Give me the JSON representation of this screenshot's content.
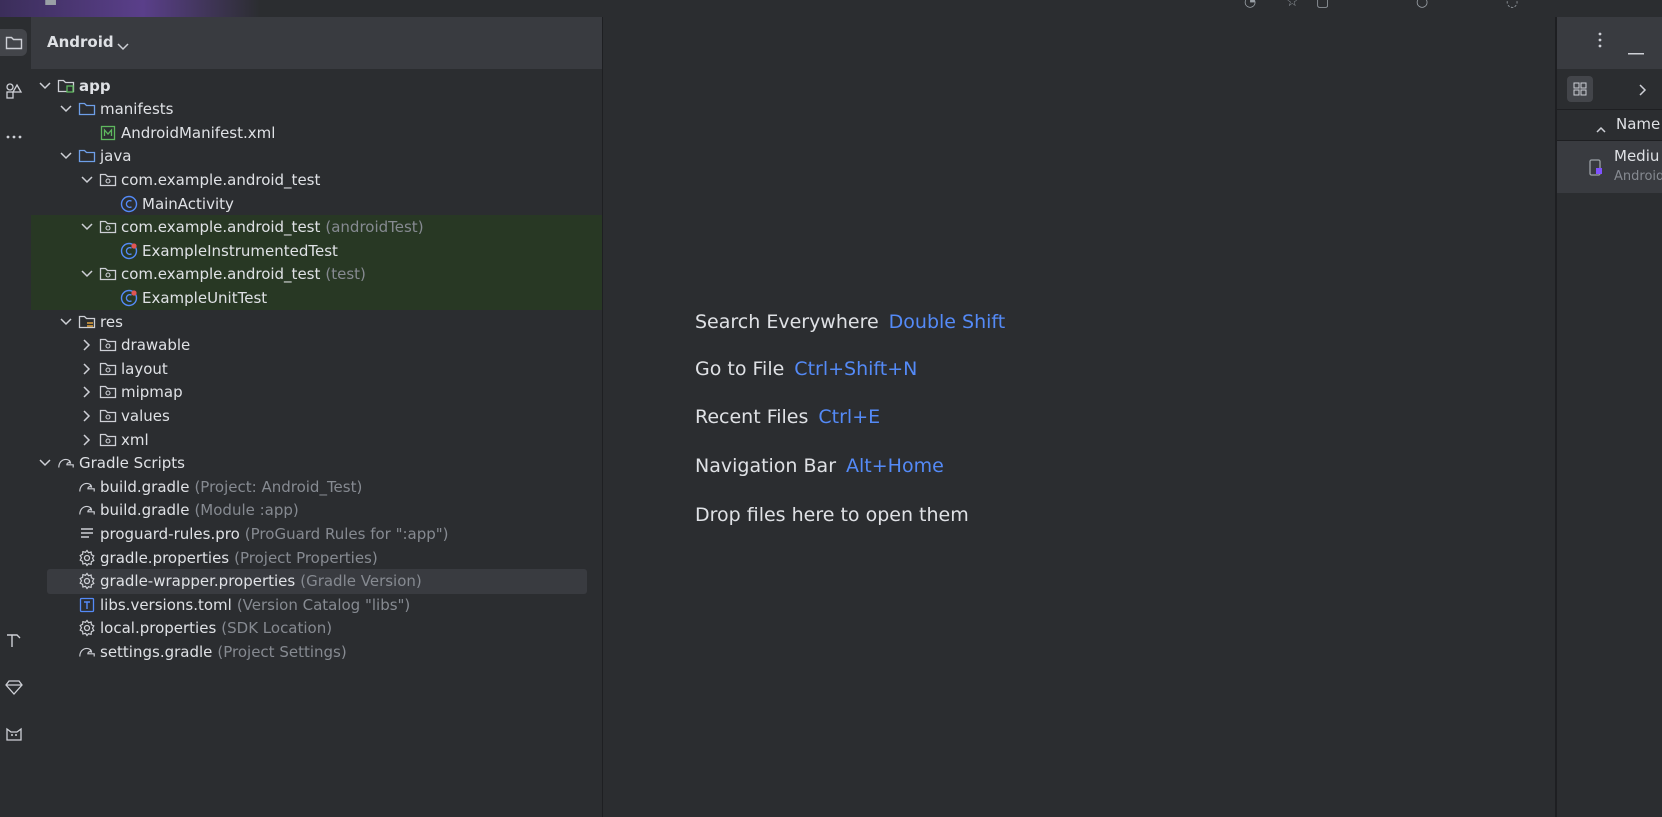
{
  "project_panel": {
    "view_title": "Android",
    "tree": [
      {
        "label": "app",
        "depth": 0,
        "expanded": true,
        "icon": "module-folder-icon",
        "bold": true
      },
      {
        "label": "manifests",
        "depth": 1,
        "expanded": true,
        "icon": "folder-icon"
      },
      {
        "label": "AndroidManifest.xml",
        "depth": 2,
        "icon": "manifest-file-icon"
      },
      {
        "label": "java",
        "depth": 1,
        "expanded": true,
        "icon": "folder-icon"
      },
      {
        "label": "com.example.android_test",
        "depth": 2,
        "expanded": true,
        "icon": "package-icon"
      },
      {
        "label": "MainActivity",
        "depth": 3,
        "icon": "class-icon"
      },
      {
        "label": "com.example.android_test",
        "hint": "(androidTest)",
        "depth": 2,
        "expanded": true,
        "icon": "package-icon",
        "highlight": true
      },
      {
        "label": "ExampleInstrumentedTest",
        "depth": 3,
        "icon": "test-class-icon",
        "highlight": true
      },
      {
        "label": "com.example.android_test",
        "hint": "(test)",
        "depth": 2,
        "expanded": true,
        "icon": "package-icon",
        "highlight": true
      },
      {
        "label": "ExampleUnitTest",
        "depth": 3,
        "icon": "test-class-icon",
        "highlight": true
      },
      {
        "label": "res",
        "depth": 1,
        "expanded": true,
        "icon": "resources-folder-icon"
      },
      {
        "label": "drawable",
        "depth": 2,
        "expanded": false,
        "icon": "package-icon"
      },
      {
        "label": "layout",
        "depth": 2,
        "expanded": false,
        "icon": "package-icon"
      },
      {
        "label": "mipmap",
        "depth": 2,
        "expanded": false,
        "icon": "package-icon"
      },
      {
        "label": "values",
        "depth": 2,
        "expanded": false,
        "icon": "package-icon"
      },
      {
        "label": "xml",
        "depth": 2,
        "expanded": false,
        "icon": "package-icon"
      },
      {
        "label": "Gradle Scripts",
        "depth": 0,
        "expanded": true,
        "icon": "gradle-icon"
      },
      {
        "label": "build.gradle",
        "hint": "(Project: Android_Test)",
        "depth": 1,
        "icon": "gradle-icon"
      },
      {
        "label": "build.gradle",
        "hint": "(Module :app)",
        "depth": 1,
        "icon": "gradle-icon"
      },
      {
        "label": "proguard-rules.pro",
        "hint": "(ProGuard Rules for \":app\")",
        "depth": 1,
        "icon": "text-file-icon"
      },
      {
        "label": "gradle.properties",
        "hint": "(Project Properties)",
        "depth": 1,
        "icon": "gear-icon"
      },
      {
        "label": "gradle-wrapper.properties",
        "hint": "(Gradle Version)",
        "depth": 1,
        "icon": "gear-icon",
        "selected": true
      },
      {
        "label": "libs.versions.toml",
        "hint": "(Version Catalog \"libs\")",
        "depth": 1,
        "icon": "toml-file-icon"
      },
      {
        "label": "local.properties",
        "hint": "(SDK Location)",
        "depth": 1,
        "icon": "gear-icon"
      },
      {
        "label": "settings.gradle",
        "hint": "(Project Settings)",
        "depth": 1,
        "icon": "gradle-icon"
      }
    ]
  },
  "editor": {
    "tips": [
      {
        "label": "Search Everywhere",
        "key": "Double Shift"
      },
      {
        "label": "Go to File",
        "key": "Ctrl+Shift+N"
      },
      {
        "label": "Recent Files",
        "key": "Ctrl+E"
      },
      {
        "label": "Navigation Bar",
        "key": "Alt+Home"
      },
      {
        "label": "Drop files here to open them",
        "key": ""
      }
    ]
  },
  "device_manager": {
    "column_name": "Name",
    "device_name": "Mediu",
    "device_sub": "Android"
  },
  "colors": {
    "accent_blue": "#548af7",
    "highlight_green": "#283824",
    "panel_bg": "#2b2d30",
    "header_bg": "#393b40"
  }
}
